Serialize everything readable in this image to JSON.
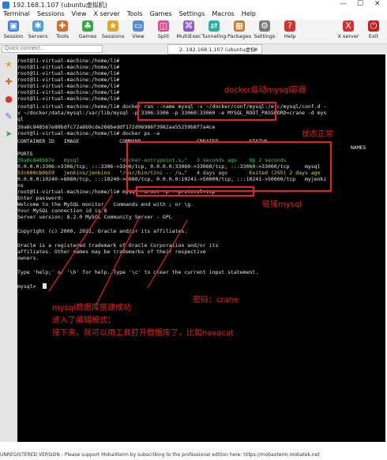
{
  "window": {
    "title": "192.168.1.107 (ubuntu虚拟机)",
    "minimize": "—",
    "maximize": "☐",
    "close": "✕"
  },
  "menu": [
    "Terminal",
    "Sessions",
    "View",
    "X server",
    "Tools",
    "Games",
    "Settings",
    "Macros",
    "Help"
  ],
  "toolbar": {
    "left": [
      {
        "label": "Session",
        "icon": "session-icon",
        "color": "#3b7dd8"
      },
      {
        "label": "Servers",
        "icon": "servers-icon",
        "color": "#4aa0e0"
      },
      {
        "label": "Tools",
        "icon": "tools-icon",
        "color": "#d86c2a"
      },
      {
        "label": "Games",
        "icon": "games-icon",
        "color": "#37a84a"
      },
      {
        "label": "Sessions",
        "icon": "sessions-icon",
        "color": "#e0a62a"
      },
      {
        "label": "View",
        "icon": "view-icon",
        "color": "#5a8ad0"
      },
      {
        "label": "Split",
        "icon": "split-icon",
        "color": "#d84a8a"
      },
      {
        "label": "MultiExec",
        "icon": "multiexec-icon",
        "color": "#8a5ad0"
      },
      {
        "label": "Tunneling",
        "icon": "tunneling-icon",
        "color": "#2ab0a0"
      },
      {
        "label": "Packages",
        "icon": "packages-icon",
        "color": "#c07a3a"
      },
      {
        "label": "Settings",
        "icon": "settings-icon",
        "color": "#7a7a7a"
      },
      {
        "label": "Help",
        "icon": "help-icon",
        "color": "#d8302a"
      }
    ],
    "right": [
      {
        "label": "X server",
        "icon": "x-server-icon",
        "color": "#d8302a"
      },
      {
        "label": "Exit",
        "icon": "exit-icon",
        "color": "#c02020"
      }
    ]
  },
  "quick_connect": {
    "placeholder": "Quick connect..."
  },
  "tab": {
    "label": "2. 192.168.1.107 (ubuntu虚拟机)",
    "close": "✕"
  },
  "terminal": {
    "prompt_lines": [
      "root@li-virtual-machine:/home/li#",
      "root@li-virtual-machine:/home/li#",
      "root@li-virtual-machine:/home/li#",
      "root@li-virtual-machine:/home/li#",
      "root@li-virtual-machine:/home/li#",
      "root@li-virtual-machine:/home/li#",
      "root@li-virtual-machine:/home/li#"
    ],
    "run_cmd_1": "root@li-virtual-machine:/home/li# docker run --name mysql -v ~/docker/conf/mysql:/etc/mysql/conf.d -",
    "run_cmd_2": "v ~/docker/data/mysql:/var/lib/mysql -p 3306:3306 -p 33060:33060 -e MYSQL_ROOT_PASSWORD=crane -d mys",
    "run_cmd_3": "ql",
    "container_id": "39a8c848567e88bdfc72a8b9cde268beddf172d96986f3982aa55259b8f7a4ce",
    "ps_cmd": "root@li-virtual-machine:/home/li# docker ps -a",
    "ps_header": "CONTAINER ID   IMAGE             COMMAND                  CREATED          STATUS",
    "ps_header_names": "NAMES",
    "ps_ports": "PORTS",
    "row1_a": "39a8c848567e   mysql             \"docker-entrypoint.s…\"   3 seconds ago    Up 2 seconds",
    "row1_b": "0.0.0.0:3306->3306/tcp, :::3306->3306/tcp, 0.0.0.0:33060->33060/tcp, :::33060->33060/tcp     mysql",
    "row2_a": "53c600cb0b59   jenkins/jenkins   \"/usr/bin/tini -- /u…\"   4 days ago       Exited (255) 2 days ago",
    "row2_b": "0.0.0.0:10240->8080/tcp, :::10240->8080/tcp, 0.0.0.0:10241->50000/tcp, :::10241->50000/tcp   myjenki",
    "row2_c": "ns",
    "login_cmd": "root@li-virtual-machine:/home/li# mysql -uroot -p --protocol=tcp",
    "pw": "Enter password:",
    "welcome": "Welcome to the MySQL monitor.  Commands end with ; or \\g.",
    "conn_id": "Your MySQL connection id is 8",
    "server_ver": "Server version: 8.2.0 MySQL Community Server - GPL",
    "copyright": "Copyright (c) 2000, 2021, Oracle and/or its affiliates.",
    "trademark1": "Oracle is a registered trademark of Oracle Corporation and/or its",
    "trademark2": "affiliates. Other names may be trademarks of their respective",
    "trademark3": "owners.",
    "help_line": "Type 'help;' or '\\h' for help. Type '\\c' to clear the current input statement.",
    "mysql_prompt": "mysql>"
  },
  "annotations": {
    "docker_start": "docker启动mysql容器",
    "status_ok": "状态正常",
    "connect": "链接mysql",
    "password": "密码：crane",
    "success1": "mysql数据库搭建成功",
    "success2": "进入了编辑模式；",
    "success3": "接下来，就可以用工具打开数据库了，比如navacat"
  },
  "status_bar": "UNREGISTERED VERSION  -  Please support MobaXterm by subscribing to the professional edition here: https://mobaxterm.mobatek.net"
}
